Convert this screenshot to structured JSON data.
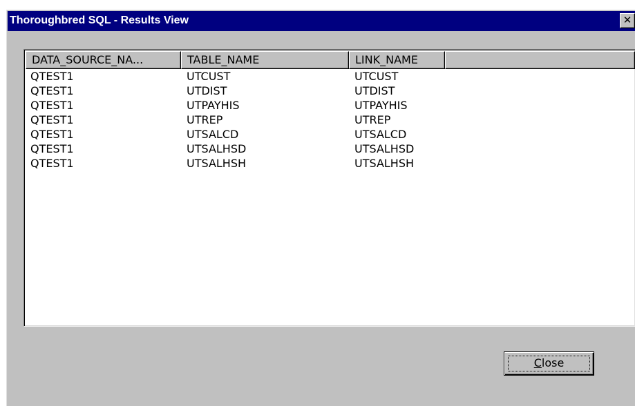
{
  "window": {
    "title": "Thoroughbred SQL - Results View",
    "close_glyph": "✕"
  },
  "results": {
    "columns": [
      "DATA_SOURCE_NA...",
      "TABLE_NAME",
      "LINK_NAME",
      ""
    ],
    "rows": [
      [
        "QTEST1",
        "UTCUST",
        "UTCUST"
      ],
      [
        "QTEST1",
        "UTDIST",
        "UTDIST"
      ],
      [
        "QTEST1",
        "UTPAYHIS",
        "UTPAYHIS"
      ],
      [
        "QTEST1",
        "UTREP",
        "UTREP"
      ],
      [
        "QTEST1",
        "UTSALCD",
        "UTSALCD"
      ],
      [
        "QTEST1",
        "UTSALHSD",
        "UTSALHSD"
      ],
      [
        "QTEST1",
        "UTSALHSH",
        "UTSALHSH"
      ]
    ]
  },
  "buttons": {
    "close_mnemonic": "C",
    "close_rest": "lose"
  },
  "colors": {
    "titlebar": "#000080",
    "face": "#c0c0c0"
  }
}
